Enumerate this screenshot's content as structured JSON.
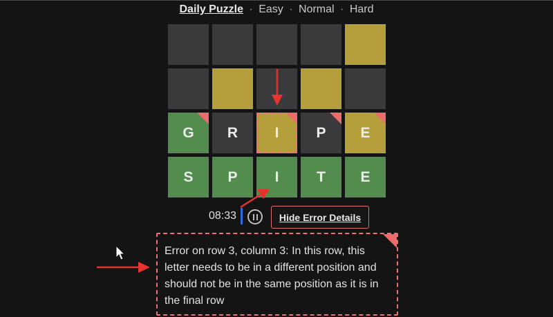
{
  "nav": {
    "active_label": "Daily Puzzle",
    "separator": "·",
    "options": [
      "Easy",
      "Normal",
      "Hard"
    ]
  },
  "board": {
    "rows": [
      [
        {
          "letter": "",
          "state": "gray"
        },
        {
          "letter": "",
          "state": "gray"
        },
        {
          "letter": "",
          "state": "gray"
        },
        {
          "letter": "",
          "state": "gray"
        },
        {
          "letter": "",
          "state": "yellow"
        }
      ],
      [
        {
          "letter": "",
          "state": "gray"
        },
        {
          "letter": "",
          "state": "yellow"
        },
        {
          "letter": "",
          "state": "gray"
        },
        {
          "letter": "",
          "state": "yellow"
        },
        {
          "letter": "",
          "state": "gray"
        }
      ],
      [
        {
          "letter": "G",
          "state": "green",
          "error": true
        },
        {
          "letter": "R",
          "state": "gray",
          "error": false
        },
        {
          "letter": "I",
          "state": "yellow",
          "error": true,
          "focused": true
        },
        {
          "letter": "P",
          "state": "gray",
          "error": true
        },
        {
          "letter": "E",
          "state": "yellow",
          "error": true
        }
      ],
      [
        {
          "letter": "S",
          "state": "green"
        },
        {
          "letter": "P",
          "state": "green"
        },
        {
          "letter": "I",
          "state": "green"
        },
        {
          "letter": "T",
          "state": "green"
        },
        {
          "letter": "E",
          "state": "green"
        }
      ]
    ]
  },
  "controls": {
    "timer": "08:33",
    "hide_errors_label": "Hide Error Details"
  },
  "error_panel": {
    "message": "Error on row 3, column 3: In this row, this letter needs to be in a different position and should not be in the same position as it is in the final row"
  },
  "colors": {
    "tile_gray": "#3a3a3c",
    "tile_yellow": "#b59f3b",
    "tile_green": "#538d4e",
    "error_accent": "#ec6b6b",
    "annotation_arrow": "#e8322e"
  },
  "icons": {
    "pause": "pause-circle-icon",
    "cursor": "mouse-pointer-icon",
    "annotation": "red-arrow-icon"
  }
}
